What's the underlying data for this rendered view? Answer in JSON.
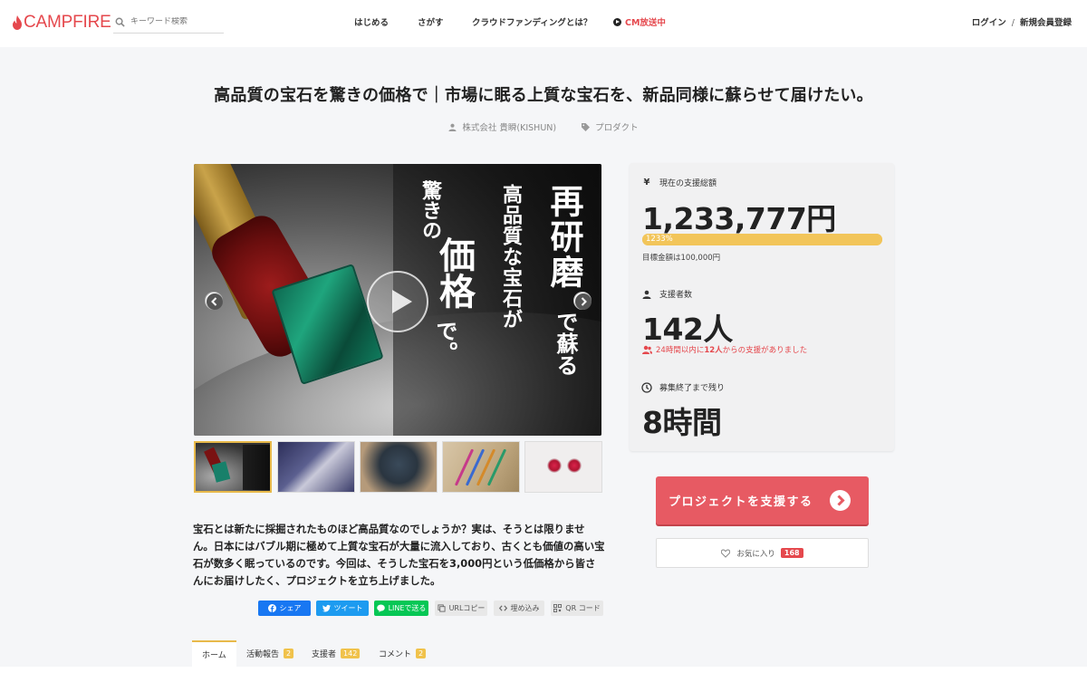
{
  "header": {
    "logo_text": "CAMPFIRE",
    "search_placeholder": "キーワード検索",
    "nav": [
      "はじめる",
      "さがす",
      "クラウドファンディングとは？",
      "CM放送中"
    ],
    "login": "ログイン",
    "separator": "/",
    "register": "新規会員登録"
  },
  "project": {
    "title": "高品質の宝石を驚きの価格で｜市場に眠る上質な宝石を、新品同様に蘇らせて届けたい。",
    "owner": "株式会社 貴瞬(KISHUN)",
    "category": "プロダクト",
    "hero_text": {
      "line1": "再研磨",
      "line1b": "で蘇る",
      "line2": "高品質な宝石が",
      "line3a": "驚きの",
      "line3b": "価格",
      "line3c": "で。"
    },
    "description": "宝石とは新たに採掘されたものほど高品質なのでしょうか？実は、そうとは限りません。日本にはバブル期に極めて上質な宝石が大量に流入しており、古くとも価値の高い宝石が数多く眠っているのです。今回は、そうした宝石を3,000円という低価格から皆さんにお届けしたく、プロジェクトを立ち上げました。"
  },
  "share": {
    "facebook": "シェア",
    "twitter": "ツイート",
    "line": "LINEで送る",
    "url_copy": "URLコピー",
    "embed": "埋め込み",
    "qr": "QR コード"
  },
  "tabs": [
    {
      "label": "ホーム",
      "badge": ""
    },
    {
      "label": "活動報告",
      "badge": "2"
    },
    {
      "label": "支援者",
      "badge": "142"
    },
    {
      "label": "コメント",
      "badge": "2"
    }
  ],
  "stats": {
    "total_label": "現在の支援総額",
    "total_icon": "¥",
    "total_value": "1,233,777円",
    "progress_text": "1233%",
    "progress_fraction": 1.0,
    "goal_text": "目標金額は100,000円",
    "backers_label": "支援者数",
    "backers_value": "142人",
    "recent_prefix": "24時間以内に",
    "recent_count": "12人",
    "recent_suffix": "からの支援がありました",
    "remaining_label": "募集終了まで残り",
    "remaining_value": "8時間"
  },
  "actions": {
    "support_label": "プロジェクトを支援する",
    "favorite_label": "お気に入り",
    "favorite_count": "168"
  },
  "colors": {
    "brand": "#e5484d",
    "progress": "#f2c55a",
    "support_button": "#e75a63",
    "tab_accent": "#e8b94a"
  }
}
